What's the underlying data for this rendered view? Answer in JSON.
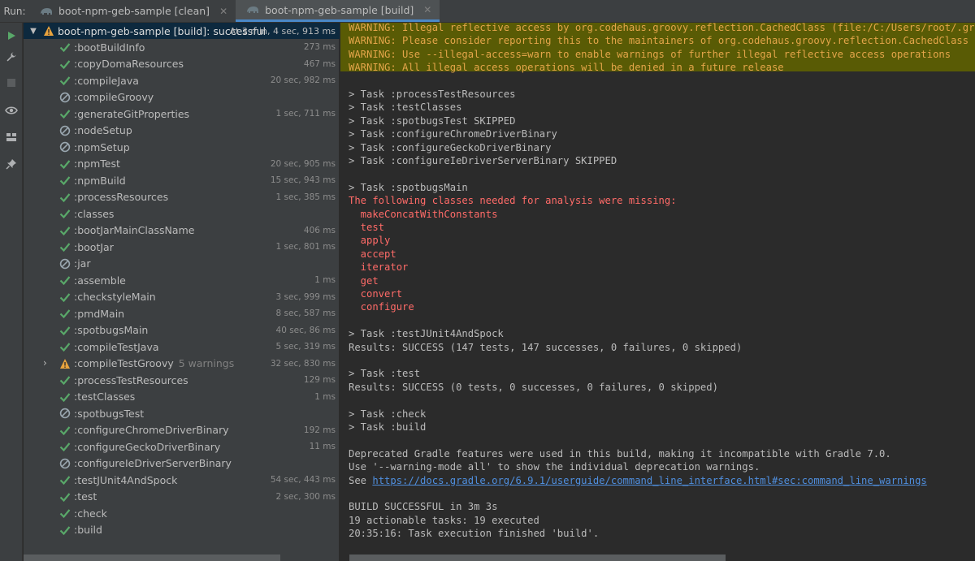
{
  "run_label": "Run:",
  "tabs": [
    {
      "label": "boot-npm-geb-sample [clean]",
      "active": false
    },
    {
      "label": "boot-npm-geb-sample [build]",
      "active": true
    }
  ],
  "toolbar_icons": [
    "run-icon",
    "wrench-icon",
    "stop-icon",
    "eye-icon",
    "layout-icon",
    "pin-icon"
  ],
  "tree": {
    "root": {
      "name": "boot-npm-geb-sample [build]:",
      "status": "successful",
      "time": "At 3 min, 4 sec, 913 ms"
    },
    "tasks": [
      {
        "name": ":bootBuildInfo",
        "status": "success",
        "time": "273 ms"
      },
      {
        "name": ":copyDomaResources",
        "status": "success",
        "time": "467 ms"
      },
      {
        "name": ":compileJava",
        "status": "success",
        "time": "20 sec, 982 ms"
      },
      {
        "name": ":compileGroovy",
        "status": "skipped",
        "time": ""
      },
      {
        "name": ":generateGitProperties",
        "status": "success",
        "time": "1 sec, 711 ms"
      },
      {
        "name": ":nodeSetup",
        "status": "skipped",
        "time": ""
      },
      {
        "name": ":npmSetup",
        "status": "skipped",
        "time": ""
      },
      {
        "name": ":npmTest",
        "status": "success",
        "time": "20 sec, 905 ms"
      },
      {
        "name": ":npmBuild",
        "status": "success",
        "time": "15 sec, 943 ms"
      },
      {
        "name": ":processResources",
        "status": "success",
        "time": "1 sec, 385 ms"
      },
      {
        "name": ":classes",
        "status": "success",
        "time": ""
      },
      {
        "name": ":bootJarMainClassName",
        "status": "success",
        "time": "406 ms"
      },
      {
        "name": ":bootJar",
        "status": "success",
        "time": "1 sec, 801 ms"
      },
      {
        "name": ":jar",
        "status": "skipped",
        "time": ""
      },
      {
        "name": ":assemble",
        "status": "success",
        "time": "1 ms"
      },
      {
        "name": ":checkstyleMain",
        "status": "success",
        "time": "3 sec, 999 ms"
      },
      {
        "name": ":pmdMain",
        "status": "success",
        "time": "8 sec, 587 ms"
      },
      {
        "name": ":spotbugsMain",
        "status": "success",
        "time": "40 sec, 86 ms"
      },
      {
        "name": ":compileTestJava",
        "status": "success",
        "time": "5 sec, 319 ms"
      },
      {
        "name": ":compileTestGroovy",
        "status": "warning",
        "warnings": "5 warnings",
        "time": "32 sec, 830 ms"
      },
      {
        "name": ":processTestResources",
        "status": "success",
        "time": "129 ms"
      },
      {
        "name": ":testClasses",
        "status": "success",
        "time": "1 ms"
      },
      {
        "name": ":spotbugsTest",
        "status": "skipped",
        "time": ""
      },
      {
        "name": ":configureChromeDriverBinary",
        "status": "success",
        "time": "192 ms"
      },
      {
        "name": ":configureGeckoDriverBinary",
        "status": "success",
        "time": "11 ms"
      },
      {
        "name": ":configureIeDriverServerBinary",
        "status": "skipped",
        "time": ""
      },
      {
        "name": ":testJUnit4AndSpock",
        "status": "success",
        "time": "54 sec, 443 ms"
      },
      {
        "name": ":test",
        "status": "success",
        "time": "2 sec, 300 ms"
      },
      {
        "name": ":check",
        "status": "success",
        "time": ""
      },
      {
        "name": ":build",
        "status": "success",
        "time": ""
      }
    ]
  },
  "console": {
    "lines": [
      {
        "text": "WARNING: Illegal reflective access by org.codehaus.groovy.reflection.CachedClass (file:/C:/Users/root/.gr",
        "kind": "warn"
      },
      {
        "text": "WARNING: Please consider reporting this to the maintainers of org.codehaus.groovy.reflection.CachedClass",
        "kind": "warn"
      },
      {
        "text": "WARNING: Use --illegal-access=warn to enable warnings of further illegal reflective access operations",
        "kind": "warn"
      },
      {
        "text": "WARNING: All illegal access operations will be denied in a future release",
        "kind": "warn"
      },
      {
        "text": "",
        "kind": "normal"
      },
      {
        "text": "> Task :processTestResources",
        "kind": "normal"
      },
      {
        "text": "> Task :testClasses",
        "kind": "normal"
      },
      {
        "text": "> Task :spotbugsTest SKIPPED",
        "kind": "normal"
      },
      {
        "text": "> Task :configureChromeDriverBinary",
        "kind": "normal"
      },
      {
        "text": "> Task :configureGeckoDriverBinary",
        "kind": "normal"
      },
      {
        "text": "> Task :configureIeDriverServerBinary SKIPPED",
        "kind": "normal"
      },
      {
        "text": "",
        "kind": "normal"
      },
      {
        "text": "> Task :spotbugsMain",
        "kind": "normal"
      },
      {
        "text": "The following classes needed for analysis were missing:",
        "kind": "err"
      },
      {
        "text": "  makeConcatWithConstants",
        "kind": "err"
      },
      {
        "text": "  test",
        "kind": "err"
      },
      {
        "text": "  apply",
        "kind": "err"
      },
      {
        "text": "  accept",
        "kind": "err"
      },
      {
        "text": "  iterator",
        "kind": "err"
      },
      {
        "text": "  get",
        "kind": "err"
      },
      {
        "text": "  convert",
        "kind": "err"
      },
      {
        "text": "  configure",
        "kind": "err"
      },
      {
        "text": "",
        "kind": "normal"
      },
      {
        "text": "> Task :testJUnit4AndSpock",
        "kind": "normal"
      },
      {
        "text": "Results: SUCCESS (147 tests, 147 successes, 0 failures, 0 skipped)",
        "kind": "normal"
      },
      {
        "text": "",
        "kind": "normal"
      },
      {
        "text": "> Task :test",
        "kind": "normal"
      },
      {
        "text": "Results: SUCCESS (0 tests, 0 successes, 0 failures, 0 skipped)",
        "kind": "normal"
      },
      {
        "text": "",
        "kind": "normal"
      },
      {
        "text": "> Task :check",
        "kind": "normal"
      },
      {
        "text": "> Task :build",
        "kind": "normal"
      },
      {
        "text": "",
        "kind": "normal"
      },
      {
        "text": "Deprecated Gradle features were used in this build, making it incompatible with Gradle 7.0.",
        "kind": "normal"
      },
      {
        "text": "Use '--warning-mode all' to show the individual deprecation warnings.",
        "kind": "normal"
      },
      {
        "text": "See ",
        "kind": "normal",
        "link": "https://docs.gradle.org/6.9.1/userguide/command_line_interface.html#sec:command_line_warnings"
      },
      {
        "text": "",
        "kind": "normal"
      },
      {
        "text": "BUILD SUCCESSFUL in 3m 3s",
        "kind": "normal"
      },
      {
        "text": "19 actionable tasks: 19 executed",
        "kind": "normal"
      },
      {
        "text": "20:35:16: Task execution finished 'build'.",
        "kind": "normal"
      }
    ]
  },
  "colors": {
    "success": "#59a869",
    "skipped": "#9aa7b0",
    "warning": "#e8a33d",
    "warn_text": "#e4a54a",
    "error_text": "#ff6b68",
    "selection": "#0d293e"
  }
}
